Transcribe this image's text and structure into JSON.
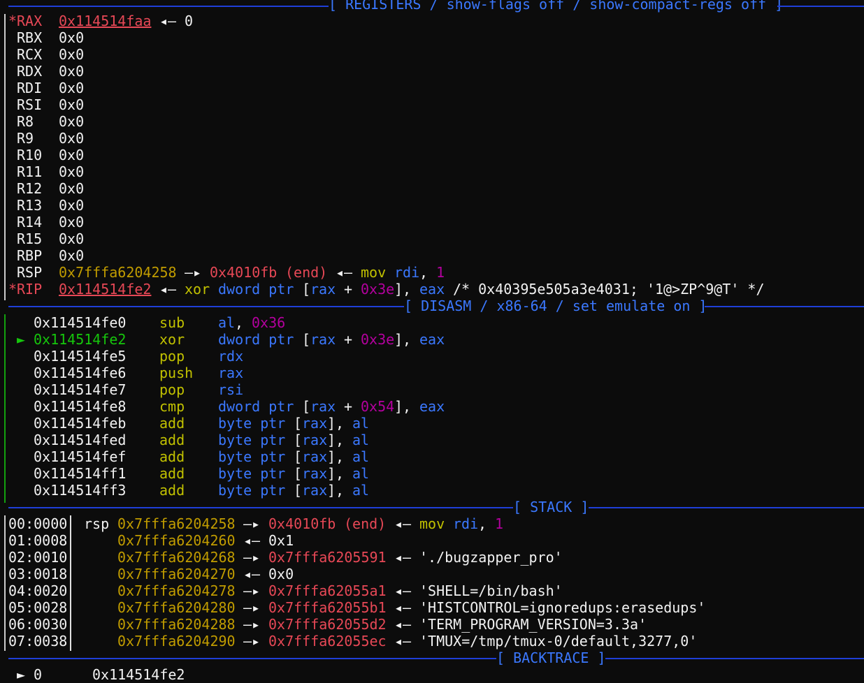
{
  "headers": {
    "registers": "[ REGISTERS / show-flags off / show-compact-regs off ]",
    "disasm": "[ DISASM / x86-64 / set emulate on ]",
    "stack": "[ STACK ]",
    "backtrace": "[ BACKTRACE ]"
  },
  "registers": {
    "rax": {
      "mark": "*",
      "name": "RAX",
      "value": "0x114514faa",
      "arrow": "◂—",
      "deref": "0"
    },
    "plain": [
      {
        "name": "RBX",
        "value": "0x0"
      },
      {
        "name": "RCX",
        "value": "0x0"
      },
      {
        "name": "RDX",
        "value": "0x0"
      },
      {
        "name": "RDI",
        "value": "0x0"
      },
      {
        "name": "RSI",
        "value": "0x0"
      },
      {
        "name": "R8",
        "value": "0x0"
      },
      {
        "name": "R9",
        "value": "0x0"
      },
      {
        "name": "R10",
        "value": "0x0"
      },
      {
        "name": "R11",
        "value": "0x0"
      },
      {
        "name": "R12",
        "value": "0x0"
      },
      {
        "name": "R13",
        "value": "0x0"
      },
      {
        "name": "R14",
        "value": "0x0"
      },
      {
        "name": "R15",
        "value": "0x0"
      },
      {
        "name": "RBP",
        "value": "0x0"
      }
    ],
    "rsp": {
      "name": "RSP",
      "value": "0x7fffa6204258",
      "arrow1": "—▸",
      "target": "0x4010fb",
      "sym": "(end)",
      "arrow2": "◂—",
      "mnem": "mov",
      "op1": "rdi",
      "comma": ",",
      "op2": "1"
    },
    "rip": {
      "mark": "*",
      "name": "RIP",
      "value": "0x114514fe2",
      "arrow": "◂—",
      "mnem": "xor",
      "ptr": "dword ptr",
      "lb": "[",
      "reg": "rax",
      "plus": "+",
      "off": "0x3e",
      "rb": "],",
      "src": "eax",
      "comment": "/* 0x40395e505a3e4031; '1@>ZP^9@T' */"
    }
  },
  "disasm": [
    {
      "marker": "",
      "addr": "0x114514fe0",
      "mnem": "sub",
      "ops": [
        {
          "t": "al",
          "c": "blue"
        },
        {
          "t": ", ",
          "c": "white"
        },
        {
          "t": "0x36",
          "c": "purple"
        }
      ]
    },
    {
      "marker": "►",
      "addr": "0x114514fe2",
      "mnem": "xor",
      "ops": [
        {
          "t": "dword ptr",
          "c": "blue"
        },
        {
          "t": " [",
          "c": "white"
        },
        {
          "t": "rax",
          "c": "blue"
        },
        {
          "t": " + ",
          "c": "white"
        },
        {
          "t": "0x3e",
          "c": "purple"
        },
        {
          "t": "], ",
          "c": "white"
        },
        {
          "t": "eax",
          "c": "blue"
        }
      ]
    },
    {
      "marker": "",
      "addr": "0x114514fe5",
      "mnem": "pop",
      "ops": [
        {
          "t": "rdx",
          "c": "blue"
        }
      ]
    },
    {
      "marker": "",
      "addr": "0x114514fe6",
      "mnem": "push",
      "ops": [
        {
          "t": "rax",
          "c": "blue"
        }
      ]
    },
    {
      "marker": "",
      "addr": "0x114514fe7",
      "mnem": "pop",
      "ops": [
        {
          "t": "rsi",
          "c": "blue"
        }
      ]
    },
    {
      "marker": "",
      "addr": "0x114514fe8",
      "mnem": "cmp",
      "ops": [
        {
          "t": "dword ptr",
          "c": "blue"
        },
        {
          "t": " [",
          "c": "white"
        },
        {
          "t": "rax",
          "c": "blue"
        },
        {
          "t": " + ",
          "c": "white"
        },
        {
          "t": "0x54",
          "c": "purple"
        },
        {
          "t": "], ",
          "c": "white"
        },
        {
          "t": "eax",
          "c": "blue"
        }
      ]
    },
    {
      "marker": "",
      "addr": "0x114514feb",
      "mnem": "add",
      "ops": [
        {
          "t": "byte ptr",
          "c": "blue"
        },
        {
          "t": " [",
          "c": "white"
        },
        {
          "t": "rax",
          "c": "blue"
        },
        {
          "t": "], ",
          "c": "white"
        },
        {
          "t": "al",
          "c": "blue"
        }
      ]
    },
    {
      "marker": "",
      "addr": "0x114514fed",
      "mnem": "add",
      "ops": [
        {
          "t": "byte ptr",
          "c": "blue"
        },
        {
          "t": " [",
          "c": "white"
        },
        {
          "t": "rax",
          "c": "blue"
        },
        {
          "t": "], ",
          "c": "white"
        },
        {
          "t": "al",
          "c": "blue"
        }
      ]
    },
    {
      "marker": "",
      "addr": "0x114514fef",
      "mnem": "add",
      "ops": [
        {
          "t": "byte ptr",
          "c": "blue"
        },
        {
          "t": " [",
          "c": "white"
        },
        {
          "t": "rax",
          "c": "blue"
        },
        {
          "t": "], ",
          "c": "white"
        },
        {
          "t": "al",
          "c": "blue"
        }
      ]
    },
    {
      "marker": "",
      "addr": "0x114514ff1",
      "mnem": "add",
      "ops": [
        {
          "t": "byte ptr",
          "c": "blue"
        },
        {
          "t": " [",
          "c": "white"
        },
        {
          "t": "rax",
          "c": "blue"
        },
        {
          "t": "], ",
          "c": "white"
        },
        {
          "t": "al",
          "c": "blue"
        }
      ]
    },
    {
      "marker": "",
      "addr": "0x114514ff3",
      "mnem": "add",
      "ops": [
        {
          "t": "byte ptr",
          "c": "blue"
        },
        {
          "t": " [",
          "c": "white"
        },
        {
          "t": "rax",
          "c": "blue"
        },
        {
          "t": "], ",
          "c": "white"
        },
        {
          "t": "al",
          "c": "blue"
        }
      ]
    }
  ],
  "stack": [
    {
      "idx": "00:0000",
      "label": "rsp",
      "addr": "0x7fffa6204258",
      "arrow": "—▸",
      "target": "0x4010fb",
      "targetColor": "red",
      "sym": "(end)",
      "arrow2": "◂—",
      "rest": [
        {
          "t": "mov",
          "c": "lime"
        },
        {
          "t": " ",
          "c": "white"
        },
        {
          "t": "rdi",
          "c": "blue"
        },
        {
          "t": ", ",
          "c": "white"
        },
        {
          "t": "1",
          "c": "purple"
        }
      ]
    },
    {
      "idx": "01:0008",
      "label": "",
      "addr": "0x7fffa6204260",
      "arrow": "◂—",
      "target": "0x1",
      "targetColor": "white",
      "sym": "",
      "arrow2": "",
      "rest": []
    },
    {
      "idx": "02:0010",
      "label": "",
      "addr": "0x7fffa6204268",
      "arrow": "—▸",
      "target": "0x7fffa6205591",
      "targetColor": "red",
      "sym": "",
      "arrow2": "◂—",
      "rest": [
        {
          "t": "'./bugzapper_pro'",
          "c": "white"
        }
      ]
    },
    {
      "idx": "03:0018",
      "label": "",
      "addr": "0x7fffa6204270",
      "arrow": "◂—",
      "target": "0x0",
      "targetColor": "white",
      "sym": "",
      "arrow2": "",
      "rest": []
    },
    {
      "idx": "04:0020",
      "label": "",
      "addr": "0x7fffa6204278",
      "arrow": "—▸",
      "target": "0x7fffa62055a1",
      "targetColor": "red",
      "sym": "",
      "arrow2": "◂—",
      "rest": [
        {
          "t": "'SHELL=/bin/bash'",
          "c": "white"
        }
      ]
    },
    {
      "idx": "05:0028",
      "label": "",
      "addr": "0x7fffa6204280",
      "arrow": "—▸",
      "target": "0x7fffa62055b1",
      "targetColor": "red",
      "sym": "",
      "arrow2": "◂—",
      "rest": [
        {
          "t": "'HISTCONTROL=ignoredups:erasedups'",
          "c": "white"
        }
      ]
    },
    {
      "idx": "06:0030",
      "label": "",
      "addr": "0x7fffa6204288",
      "arrow": "—▸",
      "target": "0x7fffa62055d2",
      "targetColor": "red",
      "sym": "",
      "arrow2": "◂—",
      "rest": [
        {
          "t": "'TERM_PROGRAM_VERSION=3.3a'",
          "c": "white"
        }
      ]
    },
    {
      "idx": "07:0038",
      "label": "",
      "addr": "0x7fffa6204290",
      "arrow": "—▸",
      "target": "0x7fffa62055ec",
      "targetColor": "red",
      "sym": "",
      "arrow2": "◂—",
      "rest": [
        {
          "t": "'TMUX=/tmp/tmux-0/default,3277,0'",
          "c": "white"
        }
      ]
    }
  ],
  "backtrace": [
    {
      "marker": "►",
      "frame": "0",
      "addr": "0x114514fe2"
    }
  ]
}
